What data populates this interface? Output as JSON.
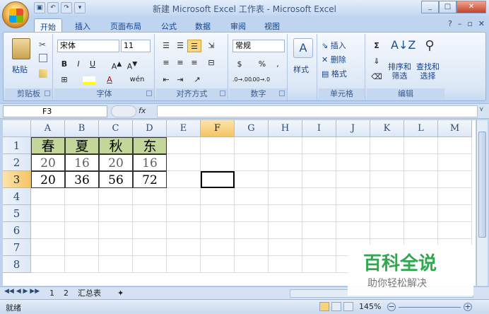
{
  "window": {
    "title": "新建 Microsoft Excel 工作表 - Microsoft Excel"
  },
  "ribbon_tabs": [
    "开始",
    "插入",
    "页面布局",
    "公式",
    "数据",
    "审阅",
    "视图"
  ],
  "ribbon": {
    "clipboard": {
      "paste": "粘贴",
      "label": "剪贴板"
    },
    "font": {
      "name": "宋体",
      "size": "11",
      "label": "字体"
    },
    "alignment": {
      "label": "对齐方式"
    },
    "number": {
      "format": "常规",
      "percent": "%",
      "comma": ",",
      "label": "数字"
    },
    "styles": {
      "label": "样式"
    },
    "cells": {
      "insert": "插入",
      "delete": "删除",
      "format": "格式",
      "label": "单元格"
    },
    "editing": {
      "sum": "Σ",
      "sort": "排序和\n筛选",
      "sort1": "排序和",
      "sort2": "筛选",
      "find1": "查找和",
      "find2": "选择",
      "label": "编辑"
    }
  },
  "formula_bar": {
    "name_box": "F3",
    "fx": "fx",
    "value": ""
  },
  "columns": [
    "A",
    "B",
    "C",
    "D",
    "E",
    "F",
    "G",
    "H",
    "I",
    "J",
    "K",
    "L",
    "M"
  ],
  "rows": [
    "1",
    "2",
    "3",
    "4",
    "5",
    "6",
    "7",
    "8"
  ],
  "cells": {
    "A1": "春",
    "B1": "夏",
    "C1": "秋",
    "D1": "东",
    "A2": "20",
    "B2": "16",
    "C2": "20",
    "D2": "16",
    "A3": "20",
    "B3": "36",
    "C3": "56",
    "D3": "72"
  },
  "colors": {
    "header_fill": "#c4d79b",
    "selection_header": "#f4c463",
    "row2_text": "#606060"
  },
  "sheets": [
    "1",
    "2",
    "汇总表"
  ],
  "status": {
    "ready": "就绪",
    "zoom": "145%"
  },
  "watermark": {
    "title": "百科全说",
    "subtitle": "助你轻松解决"
  }
}
